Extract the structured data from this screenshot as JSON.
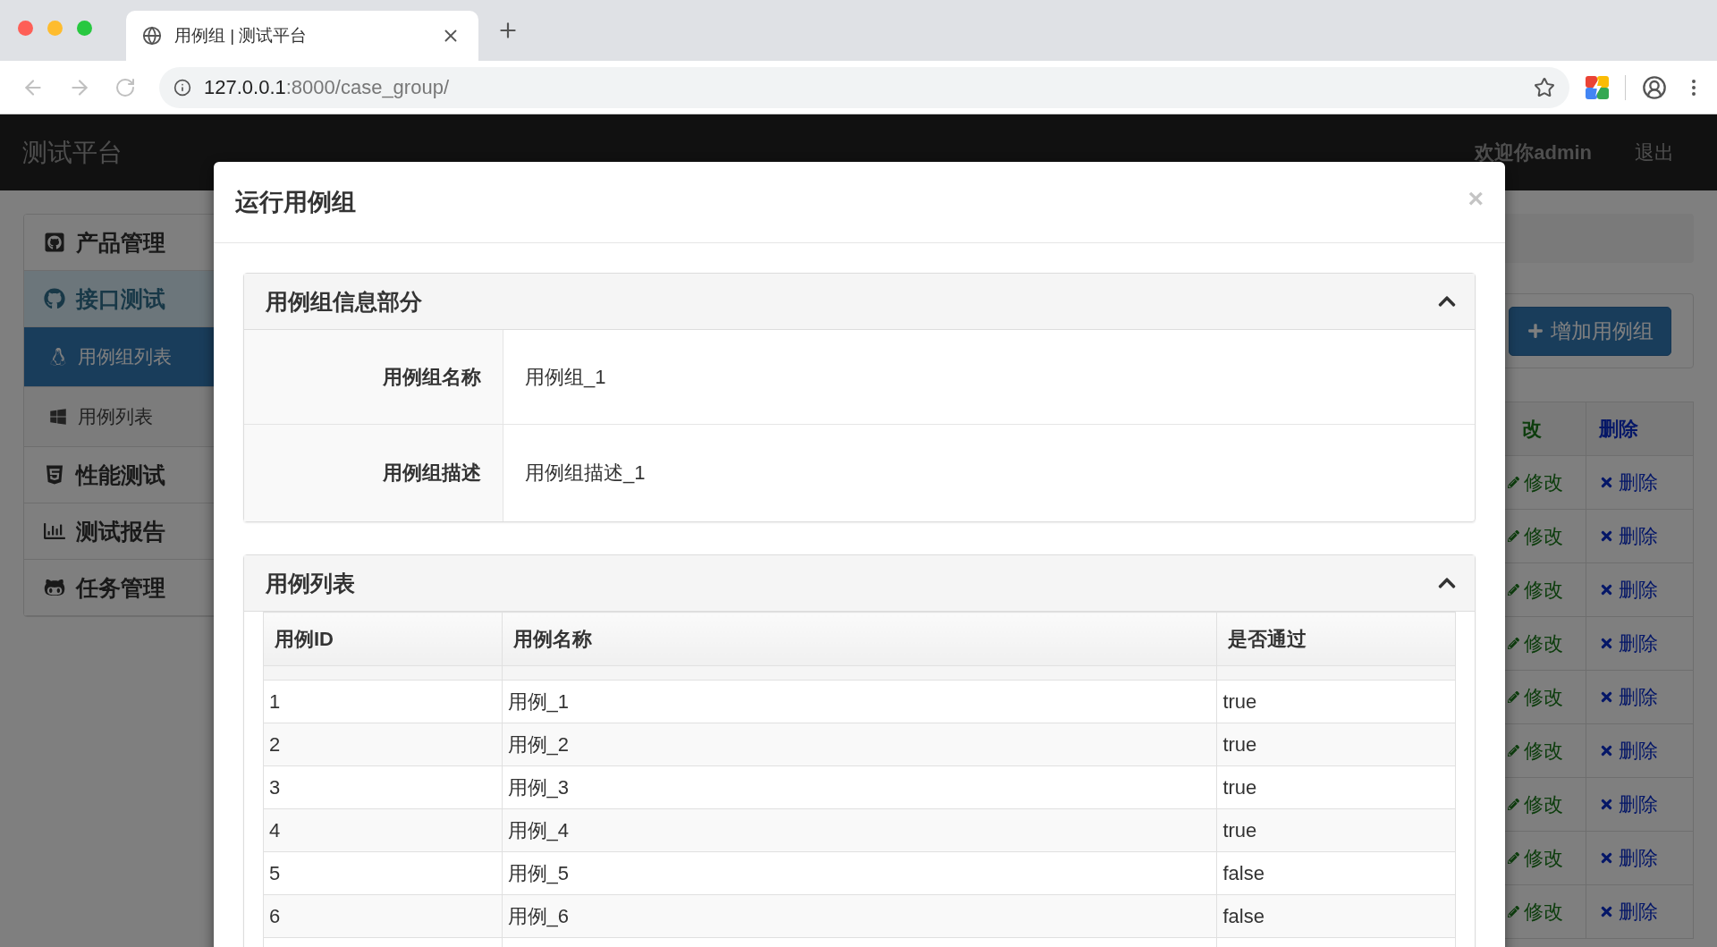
{
  "browser": {
    "tab_title": "用例组 | 测试平台",
    "url": {
      "host": "127.0.0.1",
      "path": ":8000/case_group/"
    }
  },
  "navbar": {
    "brand": "测试平台",
    "user": "欢迎你admin",
    "logout": "退出"
  },
  "sidebar": {
    "items": [
      {
        "label": "产品管理",
        "expanded": false
      },
      {
        "label": "接口测试",
        "expanded": true,
        "children": [
          {
            "label": "用例组列表",
            "selected": true
          },
          {
            "label": "用例列表",
            "selected": false
          }
        ]
      },
      {
        "label": "性能测试",
        "expanded": false
      },
      {
        "label": "测试报告",
        "expanded": false
      },
      {
        "label": "任务管理",
        "expanded": false
      }
    ]
  },
  "page": {
    "add_button": "增加用例组",
    "table": {
      "columns": [
        "改",
        "删除"
      ],
      "rows": [
        {
          "edit": "修改",
          "delete": "删除"
        },
        {
          "edit": "修改",
          "delete": "删除"
        },
        {
          "edit": "修改",
          "delete": "删除"
        },
        {
          "edit": "修改",
          "delete": "删除"
        },
        {
          "edit": "修改",
          "delete": "删除"
        },
        {
          "edit": "修改",
          "delete": "删除"
        },
        {
          "edit": "修改",
          "delete": "删除"
        },
        {
          "edit": "修改",
          "delete": "删除"
        },
        {
          "edit": "修改",
          "delete": "删除"
        }
      ]
    }
  },
  "modal": {
    "title": "运行用例组",
    "close": "×",
    "panels": [
      {
        "kind": "info",
        "title": "用例组信息部分",
        "expanded": true,
        "fields": [
          {
            "label": "用例组名称",
            "value": "用例组_1"
          },
          {
            "label": "用例组描述",
            "value": "用例组描述_1"
          }
        ]
      },
      {
        "kind": "table",
        "title": "用例列表",
        "expanded": true,
        "columns": [
          "用例ID",
          "用例名称",
          "是否通过"
        ],
        "rows": [
          [
            "1",
            "用例_1",
            "true"
          ],
          [
            "2",
            "用例_2",
            "true"
          ],
          [
            "3",
            "用例_3",
            "true"
          ],
          [
            "4",
            "用例_4",
            "true"
          ],
          [
            "5",
            "用例_5",
            "false"
          ],
          [
            "6",
            "用例_6",
            "false"
          ]
        ]
      }
    ]
  }
}
